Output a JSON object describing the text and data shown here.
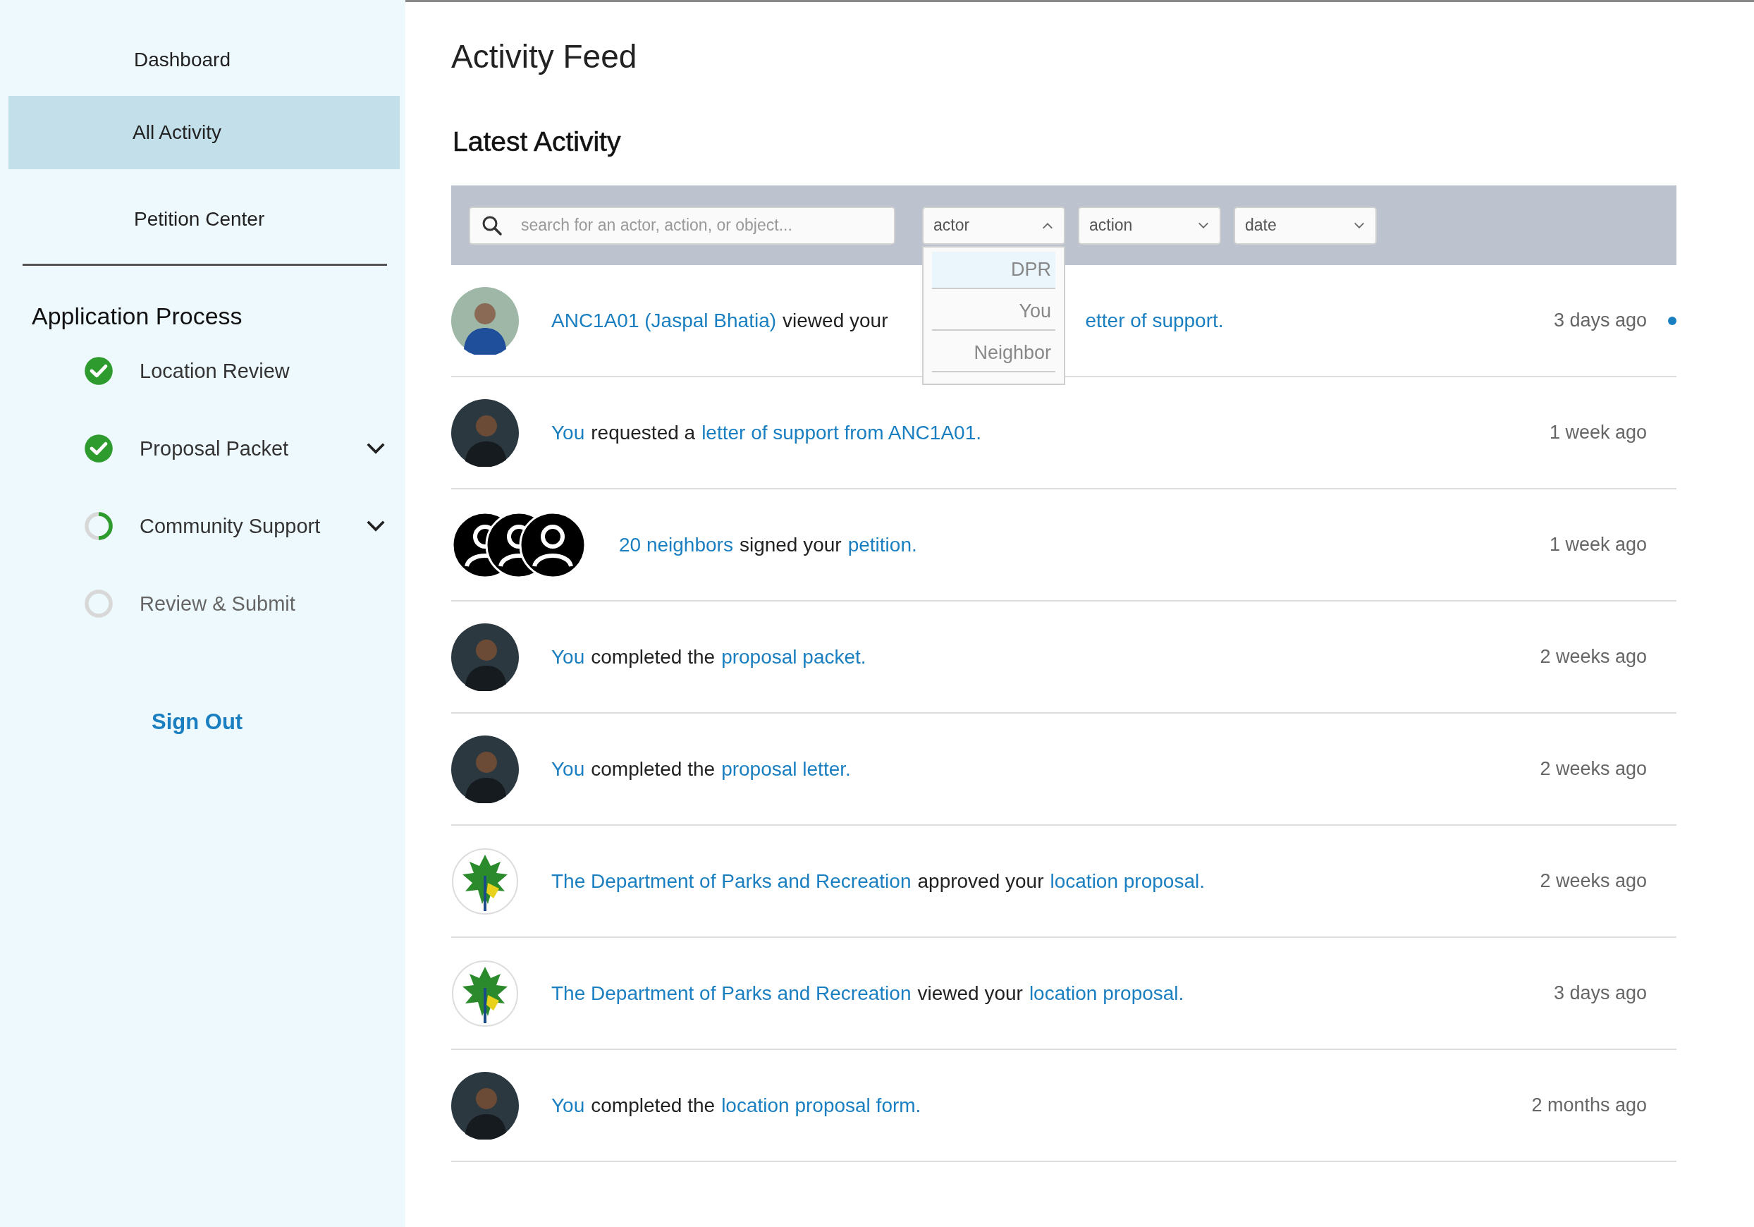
{
  "sidebar": {
    "nav": [
      {
        "label": "Dashboard",
        "selected": false
      },
      {
        "label": "All Activity",
        "selected": true
      },
      {
        "label": "Petition Center",
        "selected": false
      }
    ],
    "process": {
      "title": "Application Process",
      "steps": [
        {
          "label": "Location Review",
          "kind": "done",
          "expandable": false
        },
        {
          "label": "Proposal Packet",
          "kind": "done",
          "expandable": true
        },
        {
          "label": "Community Support",
          "kind": "partial",
          "expandable": true
        },
        {
          "label": "Review & Submit",
          "kind": "todo",
          "expandable": false
        }
      ]
    },
    "sign_out": "Sign Out"
  },
  "main": {
    "title": "Activity Feed",
    "section": "Latest Activity",
    "search": {
      "placeholder": "search for an actor, action, or object..."
    },
    "filters": [
      {
        "label": "actor",
        "expanded": true,
        "options": [
          {
            "label": "DPR",
            "selected": true
          },
          {
            "label": "You",
            "selected": false
          },
          {
            "label": "Neighbor",
            "selected": false
          }
        ]
      },
      {
        "label": "action",
        "expanded": false
      },
      {
        "label": "date",
        "expanded": false
      }
    ],
    "activities": [
      {
        "kind": "photo",
        "parts": [
          {
            "kind": "link",
            "text": "ANC1A01 (Jaspal Bhatia)"
          },
          {
            "kind": "text",
            "text": "viewed your"
          },
          {
            "kind": "gap"
          },
          {
            "kind": "link",
            "text": "etter of support."
          }
        ],
        "time": "3 days ago",
        "unread": true
      },
      {
        "kind": "person",
        "parts": [
          {
            "kind": "link",
            "text": "You"
          },
          {
            "kind": "text",
            "text": "requested a"
          },
          {
            "kind": "link",
            "text": "letter of support from ANC1A01."
          }
        ],
        "time": "1 week ago",
        "unread": false
      },
      {
        "kind": "group",
        "parts": [
          {
            "kind": "link",
            "text": "20 neighbors"
          },
          {
            "kind": "text",
            "text": "signed your"
          },
          {
            "kind": "link",
            "text": "petition."
          }
        ],
        "time": "1 week ago",
        "unread": false
      },
      {
        "kind": "person",
        "parts": [
          {
            "kind": "link",
            "text": "You"
          },
          {
            "kind": "text",
            "text": "completed the"
          },
          {
            "kind": "link",
            "text": "proposal packet."
          }
        ],
        "time": "2 weeks ago",
        "unread": false
      },
      {
        "kind": "person",
        "parts": [
          {
            "kind": "link",
            "text": "You"
          },
          {
            "kind": "text",
            "text": "completed the"
          },
          {
            "kind": "link",
            "text": "proposal letter."
          }
        ],
        "time": "2 weeks ago",
        "unread": false
      },
      {
        "kind": "logo",
        "parts": [
          {
            "kind": "link",
            "text": "The Department of Parks and Recreation"
          },
          {
            "kind": "text",
            "text": "approved your"
          },
          {
            "kind": "link",
            "text": "location proposal."
          }
        ],
        "time": "2 weeks ago",
        "unread": false
      },
      {
        "kind": "logo",
        "parts": [
          {
            "kind": "link",
            "text": "The Department of Parks and Recreation"
          },
          {
            "kind": "text",
            "text": "viewed your"
          },
          {
            "kind": "link",
            "text": "location proposal."
          }
        ],
        "time": "3 days ago",
        "unread": false
      },
      {
        "kind": "person",
        "parts": [
          {
            "kind": "link",
            "text": "You"
          },
          {
            "kind": "text",
            "text": "completed the"
          },
          {
            "kind": "link",
            "text": "location proposal form."
          }
        ],
        "time": "2 months ago",
        "unread": false
      }
    ]
  }
}
